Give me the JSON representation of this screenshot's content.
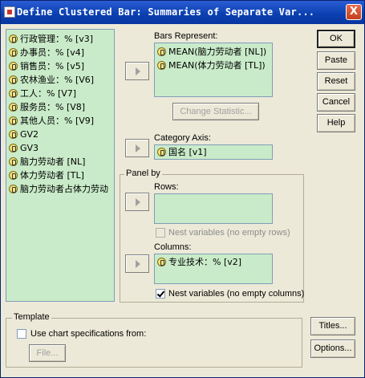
{
  "window": {
    "title": "Define Clustered Bar: Summaries of Separate Var...",
    "close_label": "X"
  },
  "variables": [
    "行政管理：% [v3]",
    "办事员：% [v4]",
    "销售员：% [v5]",
    "农林渔业：% [V6]",
    "工人：% [V7]",
    "服务员：% [V8]",
    "其他人员：% [V9]",
    "GV2",
    "GV3",
    "脑力劳动者 [NL]",
    "体力劳动者 [TL]",
    "脑力劳动者占体力劳动"
  ],
  "bars_represent": {
    "label": "Bars Represent:",
    "items": [
      "MEAN(脑力劳动者 [NL])",
      "MEAN(体力劳动者 [TL])"
    ]
  },
  "change_statistic_label": "Change Statistic...",
  "category_axis": {
    "label": "Category Axis:",
    "value": "国名 [v1]"
  },
  "panel_by": {
    "title": "Panel by",
    "rows_label": "Rows:",
    "rows_nest_label": "Nest variables (no empty rows)",
    "columns_label": "Columns:",
    "columns_value": "专业技术：% [v2]",
    "columns_nest_label": "Nest variables (no empty columns)",
    "columns_nest_checked": true
  },
  "template": {
    "title": "Template",
    "use_spec_label": "Use chart specifications from:",
    "file_label": "File..."
  },
  "buttons": {
    "ok": "OK",
    "paste": "Paste",
    "reset": "Reset",
    "cancel": "Cancel",
    "help": "Help",
    "titles": "Titles...",
    "options": "Options..."
  }
}
